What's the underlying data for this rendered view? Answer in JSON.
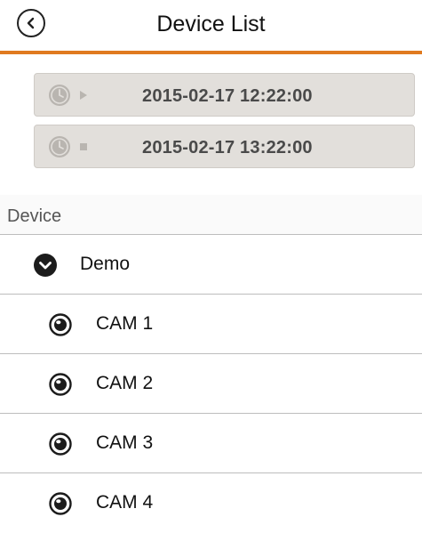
{
  "header": {
    "title": "Device List",
    "back_icon": "chevron-left-circle-icon",
    "accent_color": "#e07a1f"
  },
  "time_range": {
    "start": {
      "value": "2015-02-17 12:22:00",
      "icon": "clock-icon",
      "control_icon": "play-icon"
    },
    "end": {
      "value": "2015-02-17 13:22:00",
      "icon": "clock-icon",
      "control_icon": "stop-icon"
    }
  },
  "devices": {
    "section_label": "Device",
    "group": {
      "label": "Demo",
      "icon": "chevron-down-circle-icon"
    },
    "cameras": [
      {
        "label": "CAM 1",
        "icon": "camera-radio-icon"
      },
      {
        "label": "CAM 2",
        "icon": "camera-radio-icon"
      },
      {
        "label": "CAM 3",
        "icon": "camera-radio-icon"
      },
      {
        "label": "CAM 4",
        "icon": "camera-radio-icon"
      }
    ]
  }
}
